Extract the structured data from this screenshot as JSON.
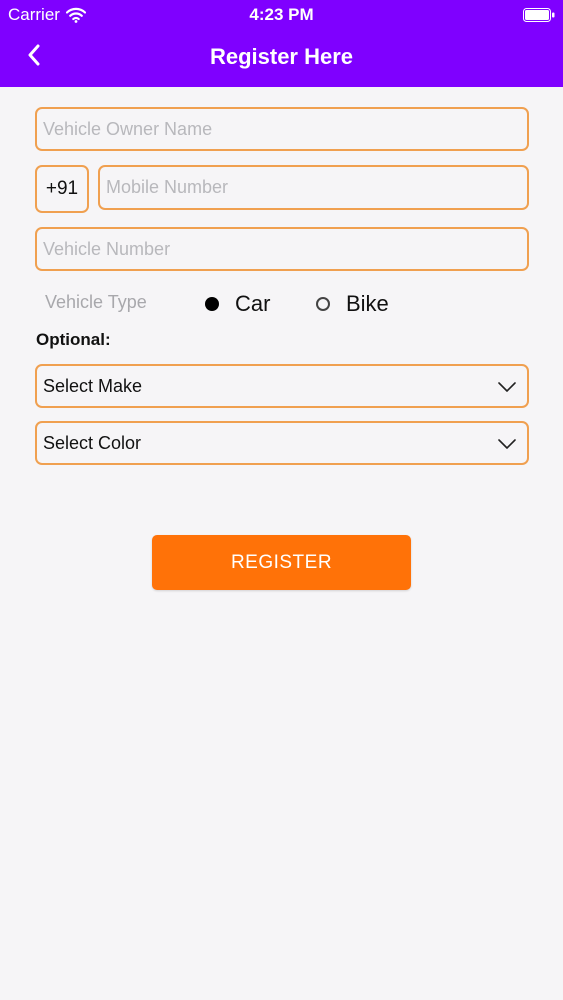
{
  "status_bar": {
    "carrier": "Carrier",
    "time": "4:23 PM"
  },
  "header": {
    "title": "Register Here"
  },
  "form": {
    "owner_name": {
      "placeholder": "Vehicle Owner Name",
      "value": ""
    },
    "country_code": "+91",
    "mobile": {
      "placeholder": "Mobile Number",
      "value": ""
    },
    "vehicle_number": {
      "placeholder": "Vehicle Number",
      "value": ""
    },
    "vehicle_type": {
      "label": "Vehicle Type",
      "options": [
        {
          "label": "Car",
          "selected": true
        },
        {
          "label": "Bike",
          "selected": false
        }
      ]
    },
    "optional_label": "Optional:",
    "make_select": {
      "value": "Select Make"
    },
    "color_select": {
      "value": "Select Color"
    }
  },
  "register_button": {
    "label": "REGISTER"
  },
  "colors": {
    "header_bg": "#7f00ff",
    "field_border": "#f0a050",
    "button_bg": "#ff7208",
    "page_bg": "#f6f5f7"
  },
  "icons": {
    "back": "chevron-left-icon",
    "wifi": "wifi-icon",
    "battery": "battery-icon",
    "dropdown": "chevron-down-icon"
  }
}
